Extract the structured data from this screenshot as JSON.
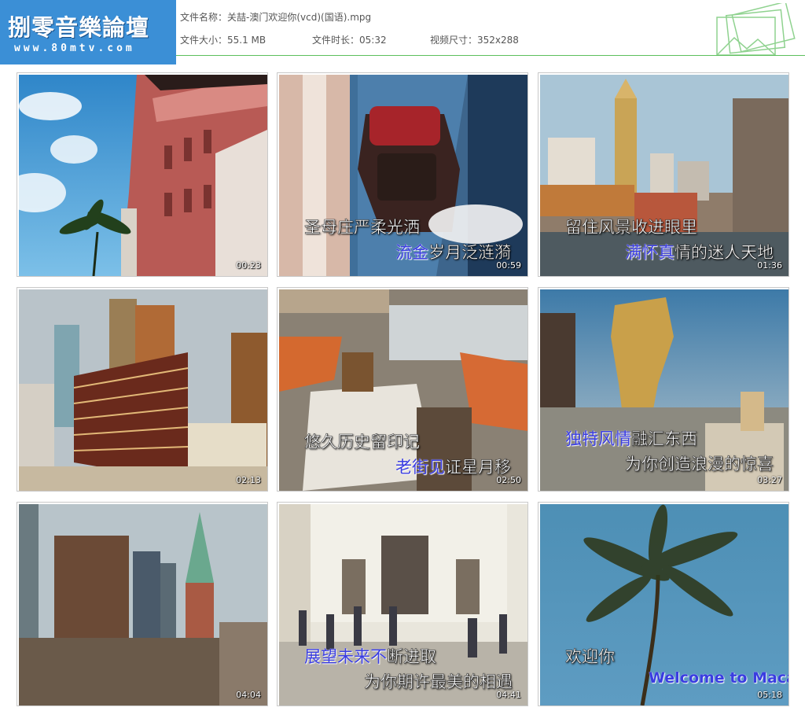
{
  "logo": {
    "title": "捌零音樂論壇",
    "url": "www.80mtv.com"
  },
  "file": {
    "name_label": "文件名称：",
    "name_value": "关喆-澳门欢迎你(vcd)(国语).mpg",
    "size_label": "文件大小：",
    "size_value": "55.1 MB",
    "duration_label": "文件时长：",
    "duration_value": "05:32",
    "dimension_label": "视频尺寸：",
    "dimension_value": "352x288"
  },
  "colors": {
    "logo_bg": "#3b8fd6",
    "rule": "#5cbf5c",
    "lyric_highlight": "#3a3de0"
  },
  "thumbnails": [
    {
      "time": "00:23",
      "lyric1": "",
      "lyric2_hl": "",
      "lyric2": ""
    },
    {
      "time": "00:59",
      "lyric1": "圣母庄严柔光洒",
      "lyric2_hl": "流金",
      "lyric2": "岁月泛涟漪"
    },
    {
      "time": "01:36",
      "lyric1": "留住风景收进眼里",
      "lyric2_hl": "满怀真",
      "lyric2": "情的迷人天地"
    },
    {
      "time": "02:13",
      "lyric1": "",
      "lyric2_hl": "",
      "lyric2": ""
    },
    {
      "time": "02:50",
      "lyric1": "悠久历史留印记",
      "lyric2_hl": "老街见",
      "lyric2": "证星月移"
    },
    {
      "time": "03:27",
      "lyric1_hl": "独特风情",
      "lyric1": "融汇东西",
      "lyric2": "为你创造浪漫的惊喜"
    },
    {
      "time": "04:04",
      "lyric1": "",
      "lyric2_hl": "",
      "lyric2": ""
    },
    {
      "time": "04:41",
      "lyric1_hl": "展望未来不",
      "lyric1": "断进取",
      "lyric2": "为你期许最美的相遇"
    },
    {
      "time": "05:18",
      "lyric1": "欢迎你",
      "lyric2_en": "Welcome to Macau"
    }
  ]
}
